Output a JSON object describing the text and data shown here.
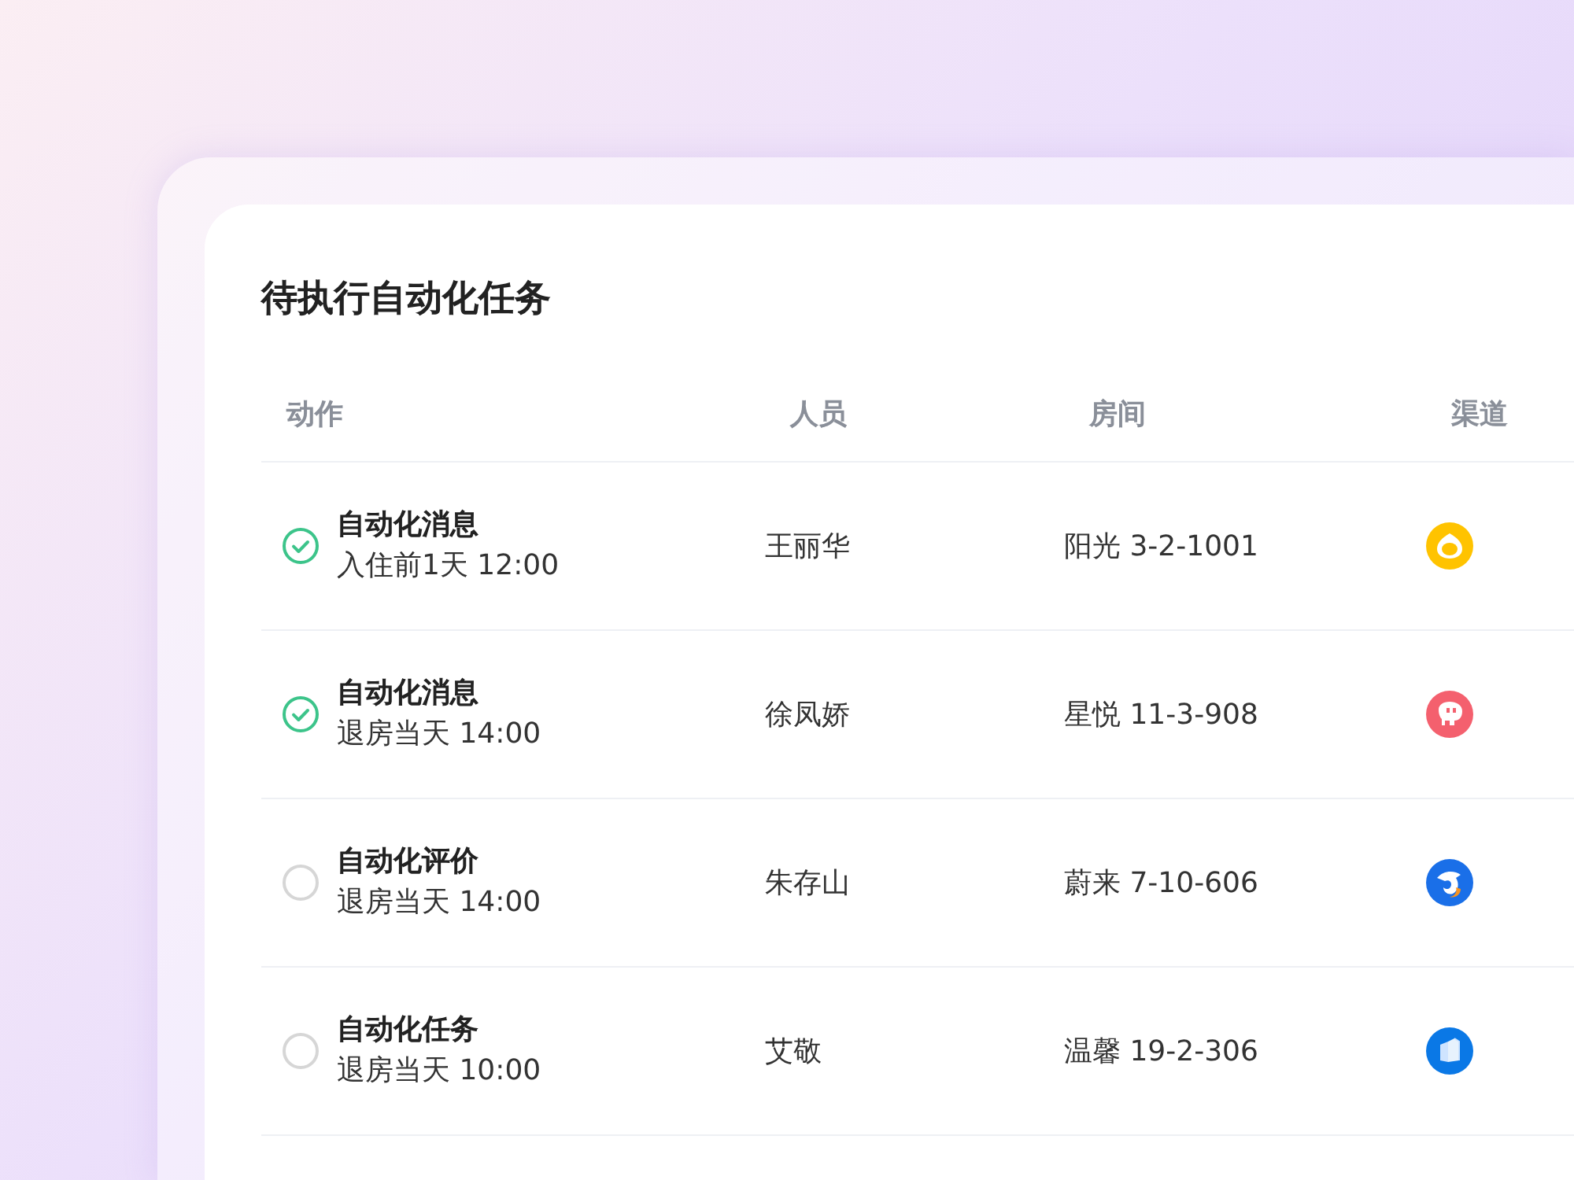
{
  "title": "待执行自动化任务",
  "columns": [
    "动作",
    "人员",
    "房间",
    "渠道"
  ],
  "rows": [
    {
      "done": true,
      "action": "自动化消息",
      "timing": "入住前1天 12:00",
      "person": "王丽华",
      "room": "阳光 3-2-1001",
      "channel": {
        "kind": "drop",
        "color": "#ffc300"
      }
    },
    {
      "done": true,
      "action": "自动化消息",
      "timing": "退房当天 14:00",
      "person": "徐凤娇",
      "room": "星悦 11-3-908",
      "channel": {
        "kind": "pig",
        "color": "#f4606e"
      }
    },
    {
      "done": false,
      "action": "自动化评价",
      "timing": "退房当天 14:00",
      "person": "朱存山",
      "room": "蔚来 7-10-606",
      "channel": {
        "kind": "dolphin",
        "color": "#1a6fe8"
      }
    },
    {
      "done": false,
      "action": "自动化任务",
      "timing": "退房当天 10:00",
      "person": "艾敬",
      "room": "温馨 19-2-306",
      "channel": {
        "kind": "building",
        "color": "#0a78e6"
      }
    }
  ]
}
